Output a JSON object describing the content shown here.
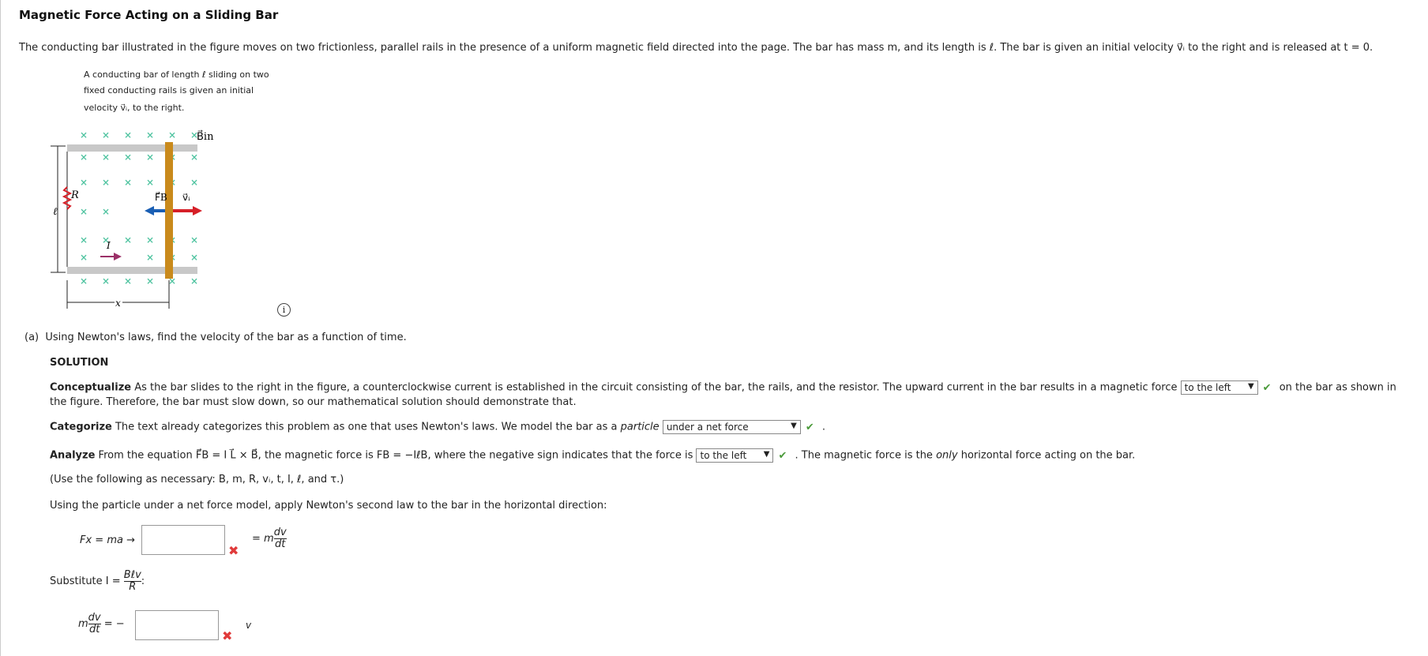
{
  "title": "Magnetic Force Acting on a Sliding Bar",
  "intro": "The conducting bar illustrated in the figure moves on two frictionless, parallel rails in the presence of a uniform magnetic field directed into the page. The bar has mass m, and its length is ℓ. The bar is given an initial velocity v⃗ᵢ to the right and is released at t = 0.",
  "figure": {
    "caption": [
      "A conducting bar of length ℓ sliding on two",
      "fixed conducting rails is given an initial",
      "velocity v⃗ᵢ, to the right."
    ],
    "labels": {
      "b": "B⃗in",
      "r": "R",
      "l": "ℓ",
      "fb": "F⃗B",
      "vi": "v⃗ᵢ",
      "i": "I",
      "x": "x"
    },
    "info": "i"
  },
  "part_a": {
    "label": "(a)",
    "question": "Using Newton's laws, find the velocity of the bar as a function of time.",
    "solution": "SOLUTION",
    "conceptualize": {
      "head": "Conceptualize",
      "text1": "As the bar slides to the right in the figure, a counterclockwise current is established in the circuit consisting of the bar, the rails, and the resistor. The upward current in the bar results in a magnetic force",
      "select": "to the left",
      "text2": "on the bar as shown in",
      "text3": "the figure. Therefore, the bar must slow down, so our mathematical solution should demonstrate that."
    },
    "categorize": {
      "head": "Categorize",
      "text1": "The text already categorizes this problem as one that uses Newton's laws. We model the bar as a",
      "italic": "particle",
      "select": "under a net force",
      "text2": "."
    },
    "analyze": {
      "head": "Analyze",
      "text1": "From the equation F⃗B = I L⃗ × B⃗, the magnetic force is FB = −IℓB, where the negative sign indicates that the force is",
      "select": "to the left",
      "text2": ". The magnetic force is the",
      "italic": "only",
      "text3": "horizontal force acting on the bar."
    },
    "use_following": "(Use the following as necessary: B, m, R, vᵢ, t, I, ℓ, and τ.)",
    "newton": "Using the particle under a net force model, apply Newton's second law to the bar in the horizontal direction:",
    "eq1": {
      "lhs": "Fx = ma →",
      "rhs": "= m",
      "num": "dv",
      "den": "dt",
      "value": ""
    },
    "substitute": {
      "text": "Substitute I =",
      "num": "Bℓv",
      "den": "R",
      "colon": ":"
    },
    "eq2": {
      "lhs_m": "m",
      "num": "dv",
      "den": "dt",
      "eq": "= −",
      "value": "",
      "rhs": "v"
    },
    "check": "✔",
    "cross": "✖"
  },
  "colors": {
    "check": "#4a9a3a",
    "cross": "#e03a3a",
    "field": "#4fc3a0",
    "bar": "#c98a1c",
    "fb": "#1a5fb4",
    "vi": "#d62028",
    "current": "#9b3068"
  }
}
